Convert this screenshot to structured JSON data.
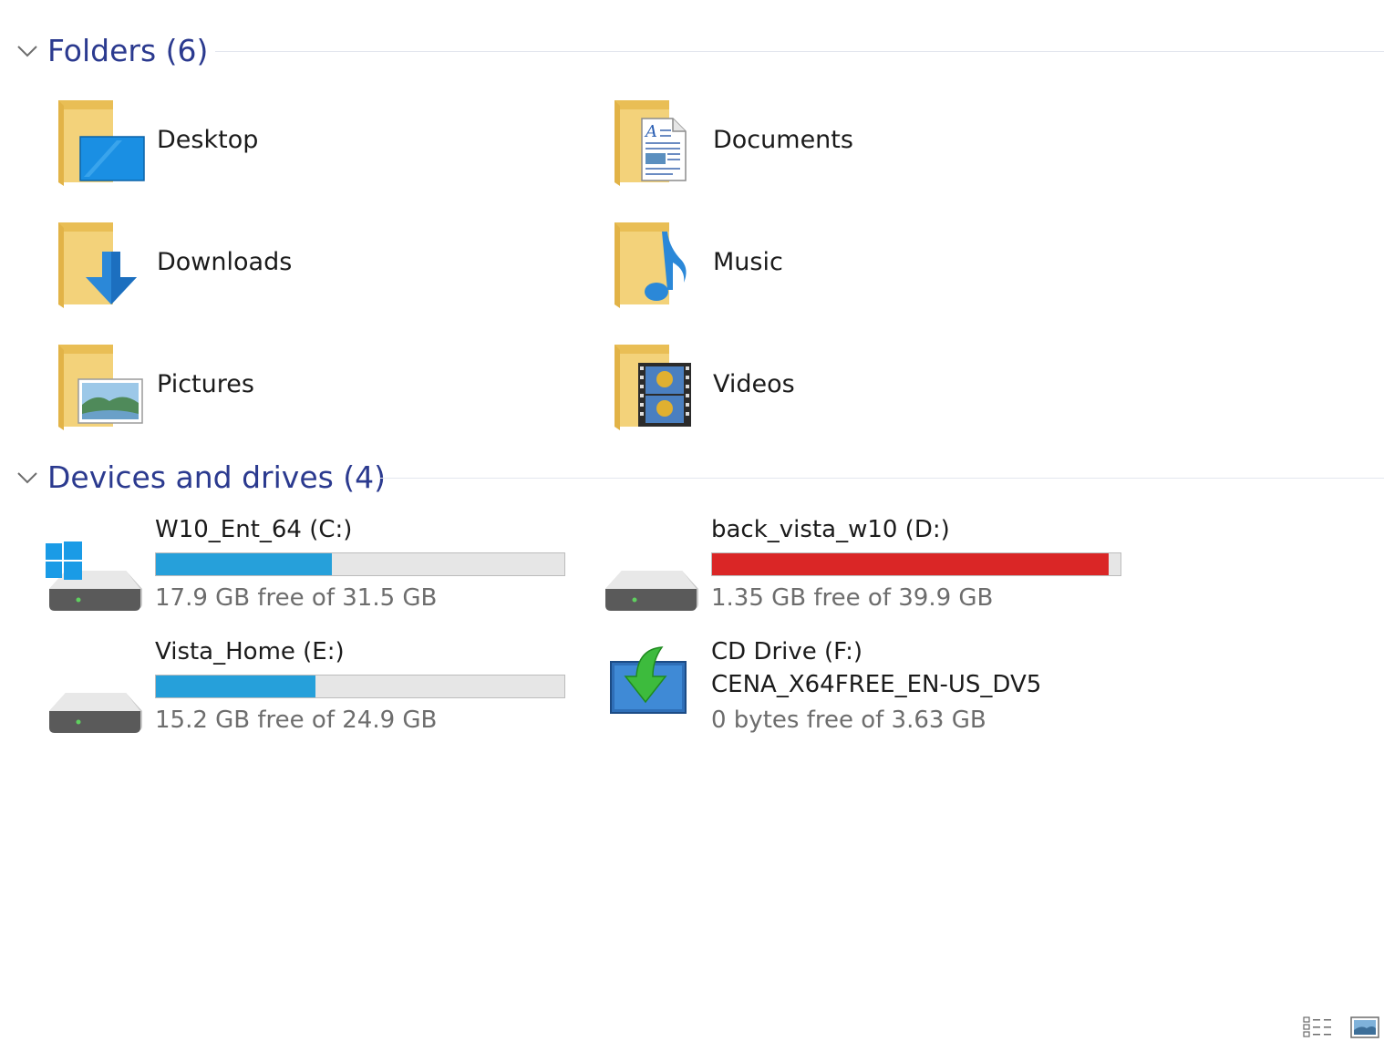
{
  "colors": {
    "header_text": "#2b3a8f",
    "bar_normal": "#26a0da",
    "bar_full": "#da2626",
    "bar_track": "#e6e6e6"
  },
  "folders_group": {
    "title": "Folders (6)",
    "icon": "chevron-down-icon",
    "items": [
      {
        "label": "Desktop",
        "icon": "desktop-folder-icon"
      },
      {
        "label": "Documents",
        "icon": "documents-folder-icon"
      },
      {
        "label": "Downloads",
        "icon": "downloads-folder-icon"
      },
      {
        "label": "Music",
        "icon": "music-folder-icon"
      },
      {
        "label": "Pictures",
        "icon": "pictures-folder-icon"
      },
      {
        "label": "Videos",
        "icon": "videos-folder-icon"
      }
    ]
  },
  "drives_group": {
    "title": "Devices and drives (4)",
    "icon": "chevron-down-icon",
    "items": [
      {
        "name": "W10_Ent_64 (C:)",
        "free_text": "17.9 GB free of 31.5 GB",
        "used_fraction": 0.43,
        "bar_state": "normal",
        "icon": "windows-drive-icon"
      },
      {
        "name": "back_vista_w10 (D:)",
        "free_text": "1.35 GB free of 39.9 GB",
        "used_fraction": 0.97,
        "bar_state": "full",
        "icon": "hard-drive-icon"
      },
      {
        "name": "Vista_Home (E:)",
        "free_text": "15.2 GB free of 24.9 GB",
        "used_fraction": 0.39,
        "bar_state": "normal",
        "icon": "hard-drive-icon"
      },
      {
        "name": "CD Drive (F:)",
        "volume_label": "CENA_X64FREE_EN-US_DV5",
        "free_text": "0 bytes free of 3.63 GB",
        "icon": "cd-drive-icon"
      }
    ]
  },
  "view_buttons": [
    {
      "icon": "details-view-icon"
    },
    {
      "icon": "large-icons-view-icon"
    }
  ]
}
